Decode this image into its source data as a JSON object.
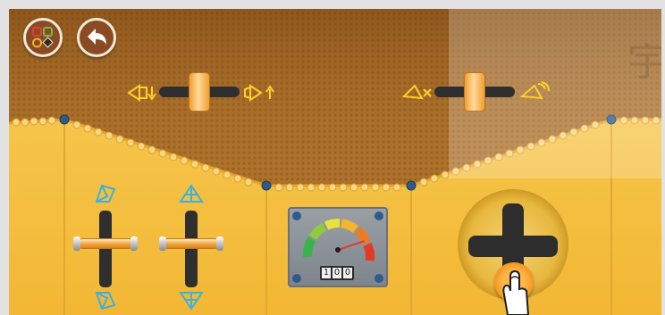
{
  "scene": {
    "toolbar": {
      "menu_button_icon": "shapes-menu-icon",
      "back_button_icon": "back-arrow-icon"
    },
    "ceiling_sliders": [
      {
        "name": "horn-volume-slider",
        "left_icon": "horn-down-icon",
        "right_icon": "horn-up-icon",
        "value": 0.5
      },
      {
        "name": "horn-toggle-slider",
        "left_icon": "horn-mute-icon",
        "right_icon": "horn-on-icon",
        "value": 0.5
      }
    ],
    "cockpit": {
      "odometer_digits": [
        "1",
        "0",
        "0"
      ],
      "speed_level": 0.85,
      "vertical_levers": [
        {
          "name": "lever-left",
          "top_icon": "wing-up-icon",
          "bottom_icon": "wing-down-icon"
        },
        {
          "name": "lever-right",
          "top_icon": "fin-up-icon",
          "bottom_icon": "fin-down-icon"
        }
      ],
      "joystick_icon": "joystick-cross-icon",
      "hint_icon": "pointing-hand-icon"
    },
    "colors": {
      "panel_yellow": "#f7c64a",
      "ceiling_brown": "#a86a28",
      "accent_orange": "#f39a2a",
      "bolt_blue": "#2e5a8c"
    },
    "watermark_glyph": "宇"
  }
}
